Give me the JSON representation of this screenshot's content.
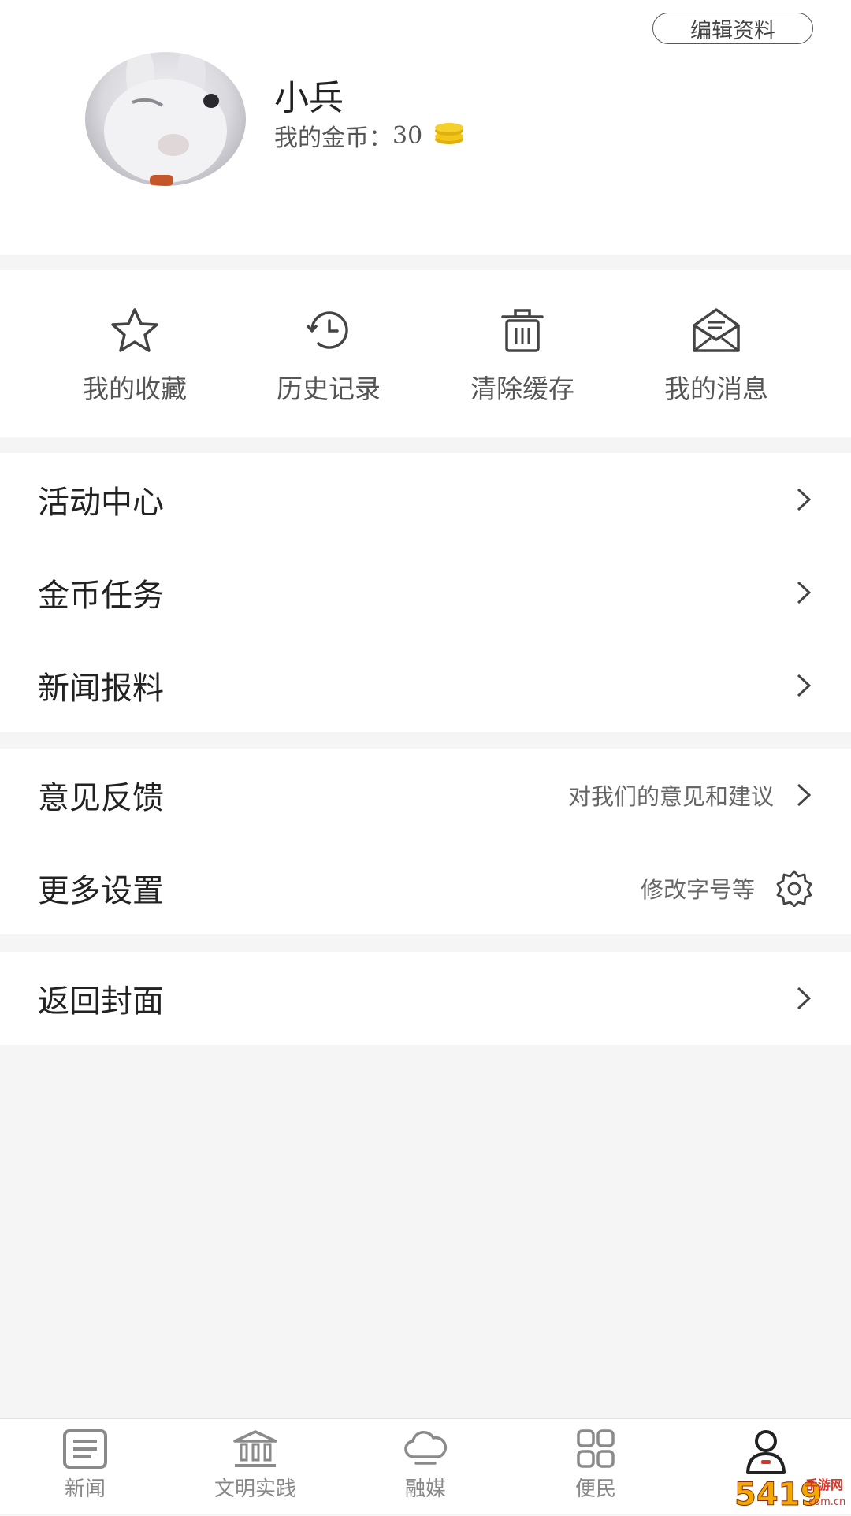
{
  "profile": {
    "edit_label": "编辑资料",
    "username": "小兵",
    "coins_label": "我的金币：",
    "coins_value": "30"
  },
  "quick_actions": [
    {
      "label": "我的收藏",
      "icon": "star-icon"
    },
    {
      "label": "历史记录",
      "icon": "history-clock-icon"
    },
    {
      "label": "清除缓存",
      "icon": "trash-icon"
    },
    {
      "label": "我的消息",
      "icon": "mail-icon"
    }
  ],
  "menu_group1": [
    {
      "label": "活动中心"
    },
    {
      "label": "金币任务"
    },
    {
      "label": "新闻报料"
    }
  ],
  "menu_group2": [
    {
      "label": "意见反馈",
      "hint": "对我们的意见和建议"
    },
    {
      "label": "更多设置",
      "hint": "修改字号等"
    }
  ],
  "menu_group3": [
    {
      "label": "返回封面"
    }
  ],
  "tabs": [
    {
      "label": "新闻",
      "icon": "news-icon"
    },
    {
      "label": "文明实践",
      "icon": "building-icon"
    },
    {
      "label": "融媒",
      "icon": "cloud-icon"
    },
    {
      "label": "便民",
      "icon": "grid-icon"
    },
    {
      "label": "",
      "icon": "user-icon",
      "active": true
    }
  ],
  "watermark": {
    "text": "5419手游网",
    "sub": "com.cn"
  },
  "colors": {
    "coin": "#f2c61b",
    "accent": "#d9342b",
    "icon": "#444444"
  }
}
